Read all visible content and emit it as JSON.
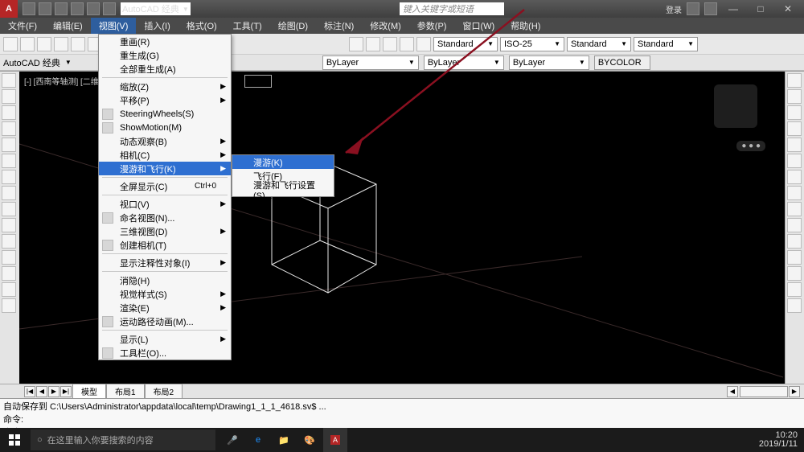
{
  "titlebar": {
    "workspace_select": "AutoCAD 经典",
    "search_placeholder": "键入关键字或短语",
    "login_label": "登录"
  },
  "menubar": {
    "items": [
      "文件(F)",
      "编辑(E)",
      "视图(V)",
      "插入(I)",
      "格式(O)",
      "工具(T)",
      "绘图(D)",
      "标注(N)",
      "修改(M)",
      "参数(P)",
      "窗口(W)",
      "帮助(H)"
    ],
    "active_index": 2
  },
  "toolbars": {
    "style_combo1": "Standard",
    "style_combo2": "ISO-25",
    "style_combo3": "Standard",
    "style_combo4": "Standard",
    "layer_combo": "ByLayer",
    "linetype_combo": "ByLayer",
    "lineweight_combo": "ByLayer",
    "color_combo": "BYCOLOR",
    "workspace_row": "AutoCAD 经典"
  },
  "viewport": {
    "label": "[-] [西南等轴测] [二维线框]"
  },
  "dropdown": {
    "items": [
      {
        "label": "重画(R)",
        "icon": false,
        "sub": false
      },
      {
        "label": "重生成(G)",
        "icon": false,
        "sub": false
      },
      {
        "label": "全部重生成(A)",
        "icon": false,
        "sub": false,
        "sep_after": true
      },
      {
        "label": "缩放(Z)",
        "icon": false,
        "sub": true
      },
      {
        "label": "平移(P)",
        "icon": false,
        "sub": true
      },
      {
        "label": "SteeringWheels(S)",
        "icon": true,
        "sub": false
      },
      {
        "label": "ShowMotion(M)",
        "icon": true,
        "sub": false
      },
      {
        "label": "动态观察(B)",
        "icon": false,
        "sub": true
      },
      {
        "label": "相机(C)",
        "icon": false,
        "sub": true
      },
      {
        "label": "漫游和飞行(K)",
        "icon": false,
        "sub": true,
        "hover": true,
        "sep_after": true
      },
      {
        "label": "全屏显示(C)",
        "icon": false,
        "sub": false,
        "shortcut": "Ctrl+0",
        "sep_after": true
      },
      {
        "label": "视口(V)",
        "icon": false,
        "sub": true
      },
      {
        "label": "命名视图(N)...",
        "icon": true,
        "sub": false
      },
      {
        "label": "三维视图(D)",
        "icon": false,
        "sub": true
      },
      {
        "label": "创建相机(T)",
        "icon": true,
        "sub": false,
        "sep_after": true
      },
      {
        "label": "显示注释性对象(I)",
        "icon": false,
        "sub": true,
        "sep_after": true
      },
      {
        "label": "消隐(H)",
        "icon": false,
        "sub": false
      },
      {
        "label": "视觉样式(S)",
        "icon": false,
        "sub": true
      },
      {
        "label": "渲染(E)",
        "icon": false,
        "sub": true
      },
      {
        "label": "运动路径动画(M)...",
        "icon": true,
        "sub": false,
        "sep_after": true
      },
      {
        "label": "显示(L)",
        "icon": false,
        "sub": true
      },
      {
        "label": "工具栏(O)...",
        "icon": true,
        "sub": false
      }
    ]
  },
  "submenu": {
    "items": [
      {
        "label": "漫游(K)",
        "hover": true
      },
      {
        "label": "飞行(F)",
        "hover": false
      },
      {
        "label": "漫游和飞行设置(S)...",
        "hover": false
      }
    ]
  },
  "tabs": {
    "items": [
      "模型",
      "布局1",
      "布局2"
    ],
    "active_index": 0
  },
  "cmdline": {
    "line1": "自动保存到 C:\\Users\\Administrator\\appdata\\local\\temp\\Drawing1_1_1_4618.sv$ ...",
    "line2": "命令:",
    "prompt": "命令:"
  },
  "taskbar": {
    "search_placeholder": "在这里输入你要搜索的内容",
    "time": "10:20",
    "date": "2019/1/11"
  }
}
